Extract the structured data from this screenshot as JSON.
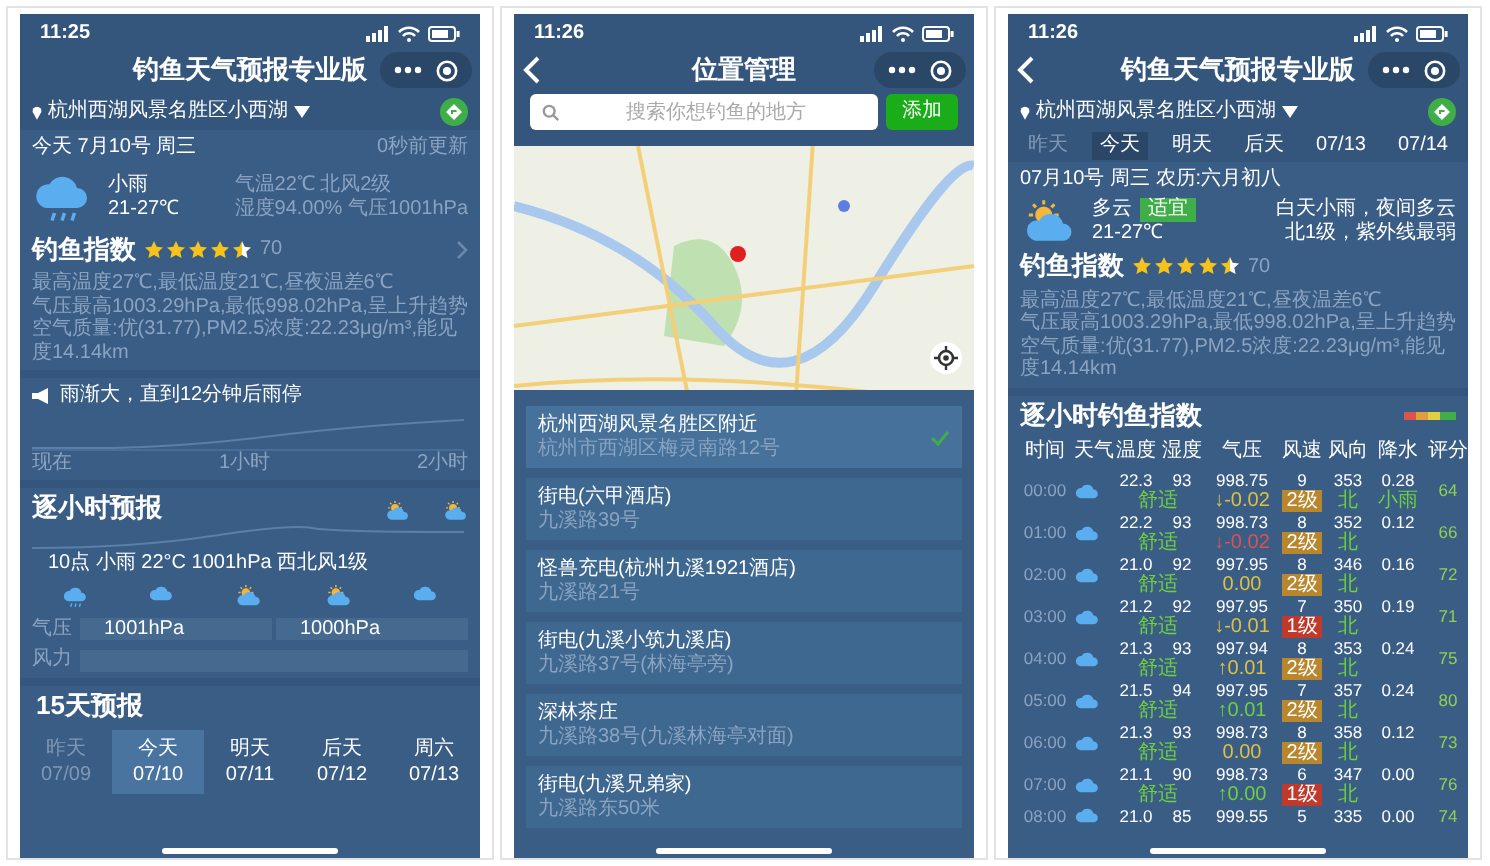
{
  "weather_screen": {
    "status_time": "11:25",
    "title": "钓鱼天气预报专业版",
    "location": "杭州西湖风景名胜区小西湖",
    "date": "今天 7月10号 周三",
    "updated": "0秒前更新",
    "weather": {
      "condition": "小雨",
      "temp_range": "21-27℃",
      "details": [
        "气温22℃ 北风2级",
        "湿度94.00% 气压1001hPa"
      ]
    },
    "fishing_index": {
      "label": "钓鱼指数",
      "stars": 4.5,
      "score": "70"
    },
    "summary": [
      "最高温度27℃,最低温度21℃,昼夜温差6℃",
      "气压最高1003.29hPa,最低998.02hPa,呈上升趋势",
      "空气质量:优(31.77),PM2.5浓度:22.23μg/m³,能见度14.14km"
    ],
    "alert": "雨渐大，直到12分钟后雨停",
    "rain_axis": [
      "现在",
      "1小时",
      "2小时"
    ],
    "hourly": {
      "title": "逐小时预报",
      "description": "10点 小雨 22°C 1001hPa 西北风1级",
      "pressure_label": "气压",
      "pressure_values": [
        "1001hPa",
        "1000hPa"
      ],
      "wind_label": "风力"
    },
    "forecast": {
      "title": "15天预报",
      "days": [
        {
          "label": "昨天",
          "date": "07/09",
          "selected": false,
          "past": true
        },
        {
          "label": "今天",
          "date": "07/10",
          "selected": true,
          "past": false
        },
        {
          "label": "明天",
          "date": "07/11",
          "selected": false,
          "past": false
        },
        {
          "label": "后天",
          "date": "07/12",
          "selected": false,
          "past": false
        },
        {
          "label": "周六",
          "date": "07/13",
          "selected": false,
          "past": false
        }
      ]
    }
  },
  "location_screen": {
    "status_time": "11:26",
    "title": "位置管理",
    "search": {
      "placeholder": "搜索你想钓鱼的地方"
    },
    "add_button": "添加",
    "places": [
      {
        "name": "杭州西湖风景名胜区附近",
        "address": "杭州市西湖区梅灵南路12号",
        "selected": true
      },
      {
        "name": "街电(六甲酒店)",
        "address": "九溪路39号",
        "selected": false
      },
      {
        "name": "怪兽充电(杭州九溪1921酒店)",
        "address": "九溪路21号",
        "selected": false
      },
      {
        "name": "街电(九溪小筑九溪店)",
        "address": "九溪路37号(林海亭旁)",
        "selected": false
      },
      {
        "name": "深林茶庄",
        "address": "九溪路38号(九溪林海亭对面)",
        "selected": false
      },
      {
        "name": "街电(九溪兄弟家)",
        "address": "九溪路东50米",
        "selected": false
      }
    ]
  },
  "index_screen": {
    "status_time": "11:26",
    "title": "钓鱼天气预报专业版",
    "location": "杭州西湖风景名胜区小西湖",
    "days": [
      {
        "label": "昨天",
        "selected": false,
        "past": true
      },
      {
        "label": "今天",
        "selected": true,
        "past": false
      },
      {
        "label": "明天",
        "selected": false,
        "past": false
      },
      {
        "label": "后天",
        "selected": false,
        "past": false
      },
      {
        "label": "07/13",
        "selected": false,
        "past": false
      },
      {
        "label": "07/14",
        "selected": false,
        "past": false
      }
    ],
    "date_line": "07月10号 周三 农历:六月初八",
    "weather": {
      "condition": "多云",
      "badge": "适宜",
      "temp_range": "21-27℃",
      "forecast": [
        "白天小雨，夜间多云",
        "北1级，紫外线最弱"
      ]
    },
    "fishing_index": {
      "label": "钓鱼指数",
      "stars": 4.5,
      "score": "70"
    },
    "summary": [
      "最高温度27℃,最低温度21℃,昼夜温差6℃",
      "气压最高1003.29hPa,最低998.02hPa,呈上升趋势",
      "空气质量:优(31.77),PM2.5浓度:22.23μg/m³,能见度14.14km"
    ],
    "hourly_table": {
      "title": "逐小时钓鱼指数",
      "columns": [
        "时间",
        "天气",
        "温度",
        "湿度",
        "气压",
        "风速",
        "风向",
        "降水",
        "评分"
      ],
      "rows": [
        {
          "time": "00:00",
          "temp": "22.3",
          "humidity": "93",
          "pressure": "998.75",
          "wind_speed": "9",
          "wind_dir": "353",
          "precip": "0.28",
          "comfort": "舒适",
          "trend": {
            "text": "↓-0.02",
            "color": "#e0c040"
          },
          "wind_level": {
            "text": "2级",
            "color": "#b8862c"
          },
          "direction": "北",
          "rain": "小雨",
          "score": "64"
        },
        {
          "time": "01:00",
          "temp": "22.2",
          "humidity": "93",
          "pressure": "998.73",
          "wind_speed": "8",
          "wind_dir": "352",
          "precip": "0.12",
          "comfort": "舒适",
          "trend": {
            "text": "↓-0.02",
            "color": "#d9534f"
          },
          "wind_level": {
            "text": "2级",
            "color": "#b8862c"
          },
          "direction": "北",
          "score": "66"
        },
        {
          "time": "02:00",
          "temp": "21.0",
          "humidity": "92",
          "pressure": "997.95",
          "wind_speed": "8",
          "wind_dir": "346",
          "precip": "0.16",
          "comfort": "舒适",
          "trend": {
            "text": "0.00",
            "color": "#e0c040"
          },
          "wind_level": {
            "text": "2级",
            "color": "#b8862c"
          },
          "direction": "北",
          "score": "72"
        },
        {
          "time": "03:00",
          "temp": "21.2",
          "humidity": "92",
          "pressure": "997.95",
          "wind_speed": "7",
          "wind_dir": "350",
          "precip": "0.19",
          "comfort": "舒适",
          "trend": {
            "text": "↓-0.01",
            "color": "#e0c040"
          },
          "wind_level": {
            "text": "1级",
            "color": "#c0392b"
          },
          "direction": "北",
          "score": "71"
        },
        {
          "time": "04:00",
          "temp": "21.3",
          "humidity": "93",
          "pressure": "997.94",
          "wind_speed": "8",
          "wind_dir": "353",
          "precip": "0.24",
          "comfort": "舒适",
          "trend": {
            "text": "↑0.01",
            "color": "#e0c040"
          },
          "wind_level": {
            "text": "2级",
            "color": "#b8862c"
          },
          "direction": "北",
          "score": "75"
        },
        {
          "time": "05:00",
          "temp": "21.5",
          "humidity": "94",
          "pressure": "997.95",
          "wind_speed": "7",
          "wind_dir": "357",
          "precip": "0.24",
          "comfort": "舒适",
          "trend": {
            "text": "↑0.01",
            "color": "#6fcf3f"
          },
          "wind_level": {
            "text": "2级",
            "color": "#b8862c"
          },
          "direction": "北",
          "score": "80"
        },
        {
          "time": "06:00",
          "temp": "21.3",
          "humidity": "93",
          "pressure": "998.73",
          "wind_speed": "8",
          "wind_dir": "358",
          "precip": "0.12",
          "comfort": "舒适",
          "trend": {
            "text": "0.00",
            "color": "#e0c040"
          },
          "wind_level": {
            "text": "2级",
            "color": "#b8862c"
          },
          "direction": "北",
          "score": "73"
        },
        {
          "time": "07:00",
          "temp": "21.1",
          "humidity": "90",
          "pressure": "998.73",
          "wind_speed": "6",
          "wind_dir": "347",
          "precip": "0.00",
          "comfort": "舒适",
          "trend": {
            "text": "↑0.00",
            "color": "#6fcf3f"
          },
          "wind_level": {
            "text": "1级",
            "color": "#c0392b"
          },
          "direction": "北",
          "score": "76"
        },
        {
          "time": "08:00",
          "temp": "21.0",
          "humidity": "85",
          "pressure": "999.55",
          "wind_speed": "5",
          "wind_dir": "335",
          "precip": "0.00",
          "score": "74"
        }
      ]
    }
  }
}
